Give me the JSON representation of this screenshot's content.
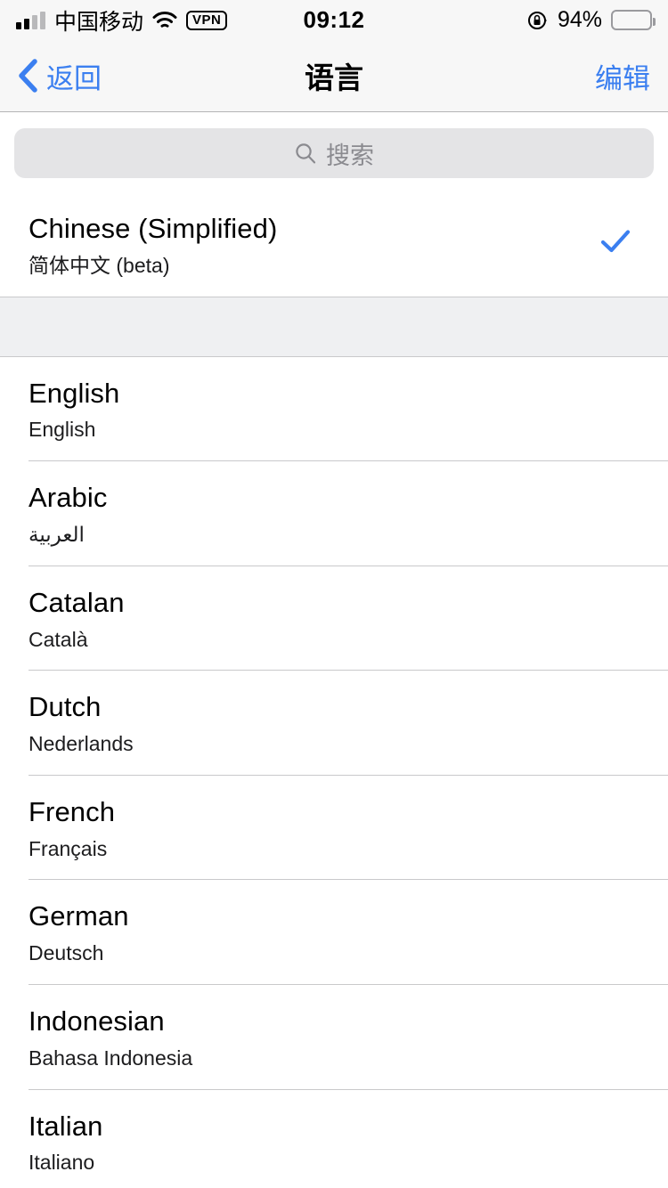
{
  "status_bar": {
    "carrier": "中国移动",
    "vpn_label": "VPN",
    "time": "09:12",
    "battery_percent": "94%",
    "signal_icon": "signal-bars-icon",
    "wifi_icon": "wifi-icon",
    "rotation_lock_icon": "rotation-lock-icon",
    "battery_icon": "battery-icon"
  },
  "nav": {
    "back_label": "返回",
    "title": "语言",
    "edit_label": "编辑",
    "back_icon": "chevron-left-icon",
    "accent_color": "#3b7ff0"
  },
  "search": {
    "placeholder": "搜索",
    "icon": "search-icon"
  },
  "selected_section": {
    "rows": [
      {
        "title": "Chinese (Simplified)",
        "subtitle": "简体中文 (beta)",
        "checked": true,
        "check_icon": "checkmark-icon",
        "check_color": "#3b7ff0"
      }
    ]
  },
  "languages_section": {
    "rows": [
      {
        "title": "English",
        "subtitle": "English"
      },
      {
        "title": "Arabic",
        "subtitle": "العربية"
      },
      {
        "title": "Catalan",
        "subtitle": "Català"
      },
      {
        "title": "Dutch",
        "subtitle": "Nederlands"
      },
      {
        "title": "French",
        "subtitle": "Français"
      },
      {
        "title": "German",
        "subtitle": "Deutsch"
      },
      {
        "title": "Indonesian",
        "subtitle": "Bahasa Indonesia"
      },
      {
        "title": "Italian",
        "subtitle": "Italiano"
      }
    ]
  }
}
